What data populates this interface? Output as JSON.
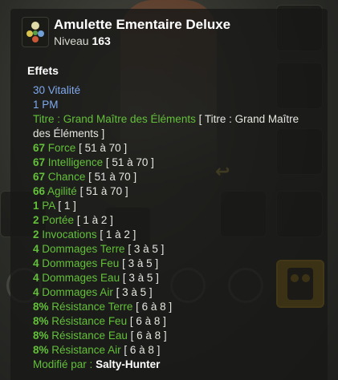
{
  "item": {
    "name": "Amulette Ementaire Deluxe",
    "level_label": "Niveau",
    "level_value": "163",
    "icon": "amulet-icon"
  },
  "effects_title": "Effets",
  "effects": [
    {
      "value": "30",
      "name": "Vitalité",
      "range": ""
    },
    {
      "value": "1",
      "name": "PM",
      "range": ""
    },
    {
      "value": "",
      "name": "Titre : Grand Maître des Éléments",
      "range": "[ Titre : Grand Maître des Éléments ]"
    },
    {
      "value": "67",
      "name": "Force",
      "range": "[ 51 à 70 ]"
    },
    {
      "value": "67",
      "name": "Intelligence",
      "range": "[ 51 à 70 ]"
    },
    {
      "value": "67",
      "name": "Chance",
      "range": "[ 51 à 70 ]"
    },
    {
      "value": "66",
      "name": "Agilité",
      "range": "[ 51 à 70 ]"
    },
    {
      "value": "1",
      "name": "PA",
      "range": "[ 1 ]"
    },
    {
      "value": "2",
      "name": "Portée",
      "range": "[ 1 à 2 ]"
    },
    {
      "value": "2",
      "name": "Invocations",
      "range": "[ 1 à 2 ]"
    },
    {
      "value": "4",
      "name": "Dommages Terre",
      "range": "[ 3 à 5 ]"
    },
    {
      "value": "4",
      "name": "Dommages Feu",
      "range": "[ 3 à 5 ]"
    },
    {
      "value": "4",
      "name": "Dommages Eau",
      "range": "[ 3 à 5 ]"
    },
    {
      "value": "4",
      "name": "Dommages Air",
      "range": "[ 3 à 5 ]"
    },
    {
      "value": "8%",
      "name": "Résistance Terre",
      "range": "[ 6 à 8 ]"
    },
    {
      "value": "8%",
      "name": "Résistance Feu",
      "range": "[ 6 à 8 ]"
    },
    {
      "value": "8%",
      "name": "Résistance Eau",
      "range": "[ 6 à 8 ]"
    },
    {
      "value": "8%",
      "name": "Résistance Air",
      "range": "[ 6 à 8 ]"
    }
  ],
  "modified": {
    "label": "Modifié par :",
    "author": "Salty-Hunter"
  },
  "colors": {
    "stat_blue": "#7fa9ec",
    "stat_green": "#63c03a",
    "range_white": "#e6e6e0",
    "slot_yellow": "#c89a14"
  }
}
